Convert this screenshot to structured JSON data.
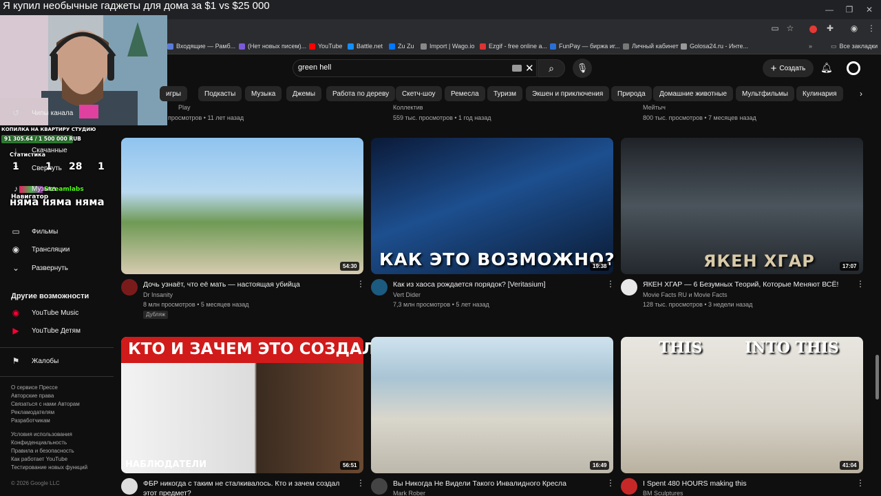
{
  "window": {
    "title": "Я купил необычные гаджеты для дома за $1 vs $25 000"
  },
  "bookmarks": [
    {
      "label": "Входящие — Рамб...",
      "color": "#5a7bd8"
    },
    {
      "label": "(Нет новых писем)...",
      "color": "#7b5ad8"
    },
    {
      "label": "YouTube",
      "color": "#ff0000"
    },
    {
      "label": "Battle.net",
      "color": "#148eff"
    },
    {
      "label": "Zu Zu",
      "color": "#0077ff"
    },
    {
      "label": "Import | Wago.io",
      "color": "#888888"
    },
    {
      "label": "Ezgif - free online a...",
      "color": "#d33"
    },
    {
      "label": "FunPay — биржа иг...",
      "color": "#2a6fd6"
    },
    {
      "label": "Личный кабинет",
      "color": "#777"
    },
    {
      "label": "Golosa24.ru - Инте...",
      "color": "#999"
    }
  ],
  "bookmarks_all": "Все закладки",
  "search": {
    "value": "green hell"
  },
  "header": {
    "create_label": "Создать"
  },
  "chips": [
    "игры",
    "Подкасты",
    "Музыка",
    "Джемы",
    "Работа по дереву",
    "Скетч-шоу",
    "Ремесла",
    "Туризм",
    "Экшен и приключения",
    "Природа",
    "Домашние животные",
    "Мультфильмы",
    "Кулинария"
  ],
  "sidebar": {
    "items": [
      {
        "icon": "history-icon",
        "glyph": "↺",
        "label": "Чипы канала"
      },
      {
        "icon": "download-icon",
        "glyph": "↓",
        "label": "Скачанные"
      },
      {
        "icon": "chevron-up-icon",
        "glyph": "⌃",
        "label": "Свернуть"
      },
      {
        "icon": "music-icon",
        "glyph": "♪",
        "label": "Музыка"
      },
      {
        "icon": "film-icon",
        "glyph": "▭",
        "label": "Фильмы"
      },
      {
        "icon": "live-icon",
        "glyph": "◉",
        "label": "Трансляции"
      },
      {
        "icon": "chevron-down-icon",
        "glyph": "⌄",
        "label": "Развернуть"
      }
    ],
    "other_heading": "Другие возможности",
    "other": [
      {
        "label": "YouTube Music"
      },
      {
        "label": "YouTube Детям"
      }
    ],
    "report": "Жалобы",
    "footer1": [
      "О сервисе  Прессе",
      "Авторские права",
      "Связаться с нами  Авторам",
      "Рекламодателям",
      "Разработчикам"
    ],
    "footer2": [
      "Условия использования",
      "Конфиденциальность",
      "Правила и безопасность",
      "Как работает YouTube",
      "Тестирование новых функций"
    ],
    "copyright": "© 2026 Google LLC"
  },
  "top_row": [
    {
      "channel": "Play",
      "meta": "просмотров • 11 лет назад"
    },
    {
      "channel": "Коллектив",
      "meta": "559 тыс. просмотров • 1 год назад"
    },
    {
      "channel": "Мейтыч",
      "meta": "800 тыс. просмотров • 7 месяцев назад"
    }
  ],
  "videos_row1": [
    {
      "title": "Дочь узнаёт, что её мать — настоящая убийца",
      "channel": "Dr Insanity",
      "meta": "8 млн просмотров • 5 месяцев назад",
      "badge": "Дубляж",
      "duration": "54:30",
      "overlay": ""
    },
    {
      "title": "Как из хаоса рождается порядок? [Veritasium]",
      "channel": "Vert Dider",
      "meta": "7,3 млн просмотров • 5 лет назад",
      "badge": "",
      "duration": "19:38",
      "overlay": "КАК ЭТО ВОЗМОЖНО?"
    },
    {
      "title": "ЯКЕН ХГАР — 6 Безумных Теорий, Которые Меняют ВСЁ!",
      "channel": "Movie Facts RU и Movie Facts",
      "meta": "128 тыс. просмотров • 3 недели назад",
      "badge": "",
      "duration": "17:07",
      "overlay": "ЯКЕН ХГАР"
    }
  ],
  "videos_row2": [
    {
      "title": "ФБР никогда с таким не сталкивалось. Кто и зачем создал",
      "title2": "этот предмет?",
      "channel": "",
      "duration": "56:51",
      "overlay": "КТО И ЗАЧЕМ ЭТО СОЗДАЛ?",
      "overlay2": "НАБЛЮДАТЕЛИ"
    },
    {
      "title": "Вы Никогда Не Видели Такого Инвалидного Кресла",
      "title2": "",
      "channel": "Mark Rober",
      "duration": "16:49",
      "overlay": "",
      "overlay2": ""
    },
    {
      "title": "I Spent 480 HOURS making this",
      "title2": "",
      "channel": "BM Sculptures",
      "duration": "41:04",
      "overlay": "THIS",
      "overlay2": "INTO THIS"
    }
  ],
  "stream": {
    "donation_label": "КОПИЛКА НА КВАРТИРУ СТУДИЮ",
    "donation_value": "91 305.64 / 1 500 000 RUB",
    "stats_label": "Статистика",
    "stats_values": [
      "1",
      "1",
      "28",
      "1"
    ],
    "streamlabs": "Streamlabs",
    "navigator": "Навигатор",
    "caption": "няма няма няма"
  }
}
